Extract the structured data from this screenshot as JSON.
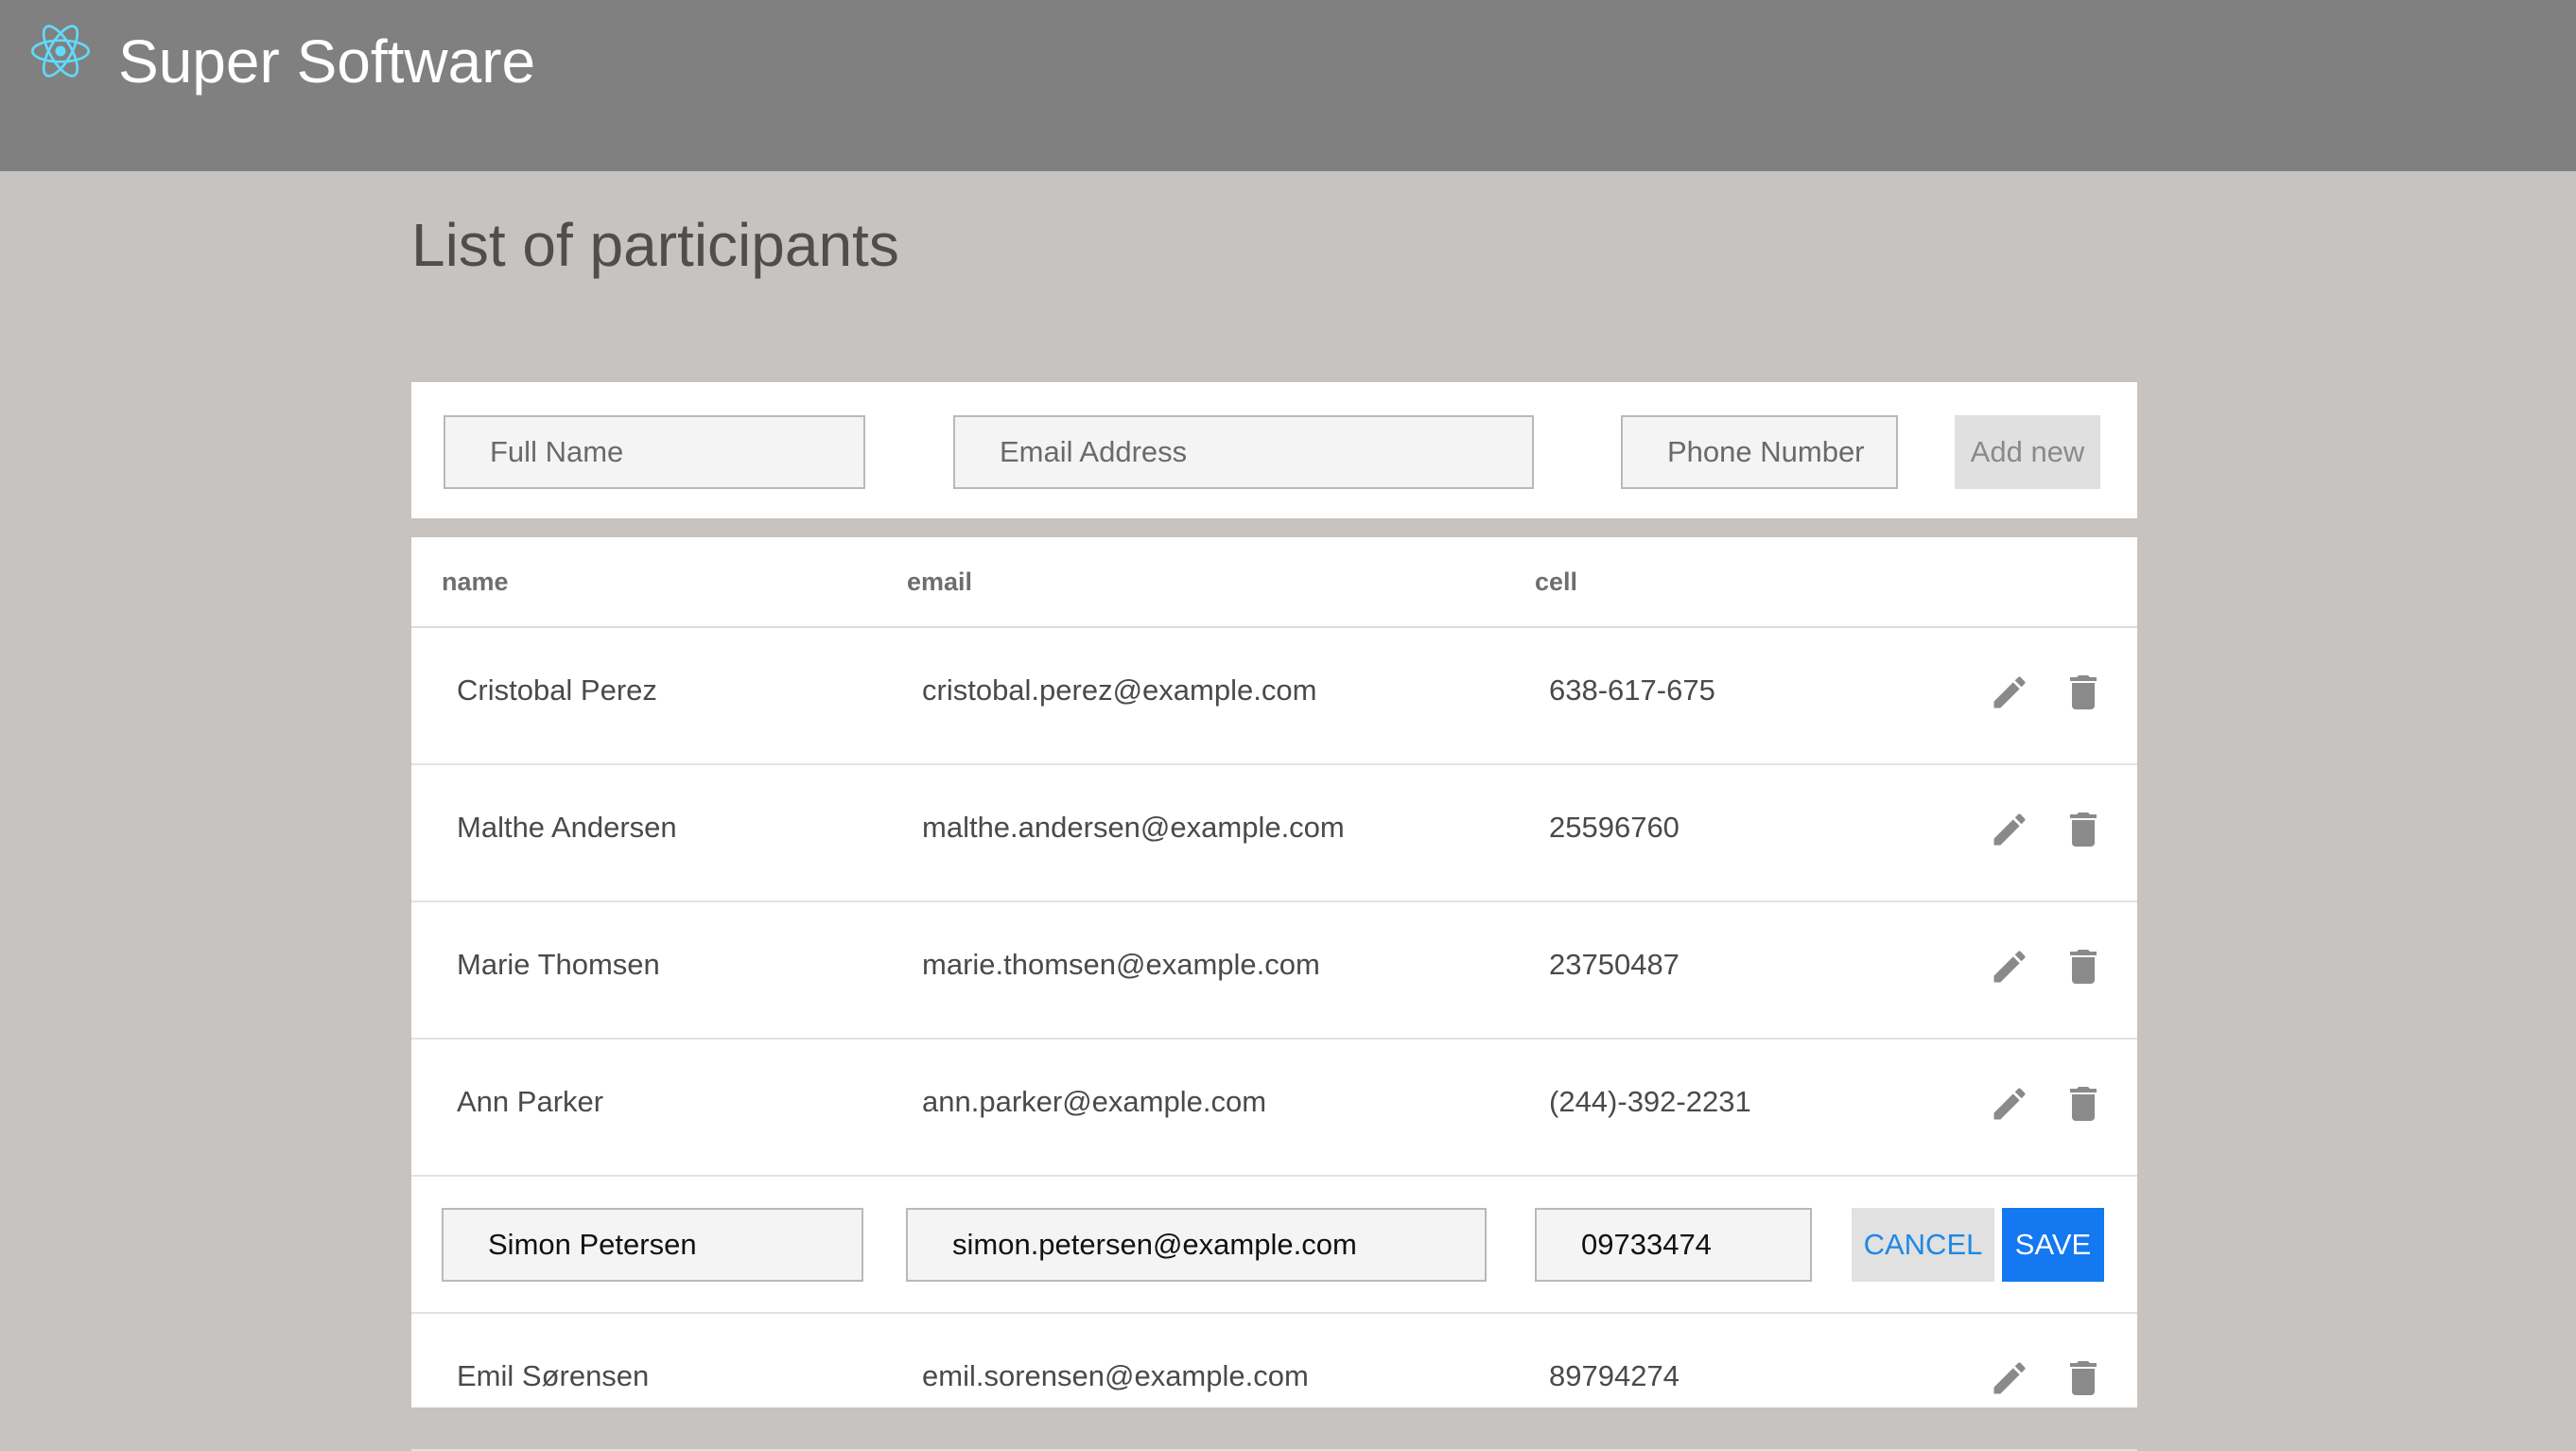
{
  "app": {
    "title": "Super Software",
    "logo_icon": "react-atom-icon",
    "accent": "#61dafb",
    "appbar_color": "#808080"
  },
  "page": {
    "title": "List of participants"
  },
  "form": {
    "name_placeholder": "Full Name",
    "email_placeholder": "Email Address",
    "phone_placeholder": "Phone Number",
    "add_label": "Add new"
  },
  "table": {
    "headers": {
      "name": "name",
      "email": "email",
      "cell": "cell"
    },
    "rows": [
      {
        "name": "Cristobal Perez",
        "email": "cristobal.perez@example.com",
        "cell": "638-617-675"
      },
      {
        "name": "Malthe Andersen",
        "email": "malthe.andersen@example.com",
        "cell": "25596760"
      },
      {
        "name": "Marie Thomsen",
        "email": "marie.thomsen@example.com",
        "cell": "23750487"
      },
      {
        "name": "Ann Parker",
        "email": "ann.parker@example.com",
        "cell": "(244)-392-2231"
      }
    ],
    "editing": {
      "name": "Simon Petersen",
      "email": "simon.petersen@example.com",
      "cell": "09733474",
      "cancel_label": "CANCEL",
      "save_label": "SAVE"
    },
    "after_rows": [
      {
        "name": "Emil Sørensen",
        "email": "emil.sorensen@example.com",
        "cell": "89794274"
      }
    ],
    "row_icons": {
      "edit": "pencil-icon",
      "delete": "trash-icon"
    },
    "icon_color": "#8a8a8a",
    "save_color": "#1478f0",
    "cancel_text_color": "#1e88e5"
  }
}
